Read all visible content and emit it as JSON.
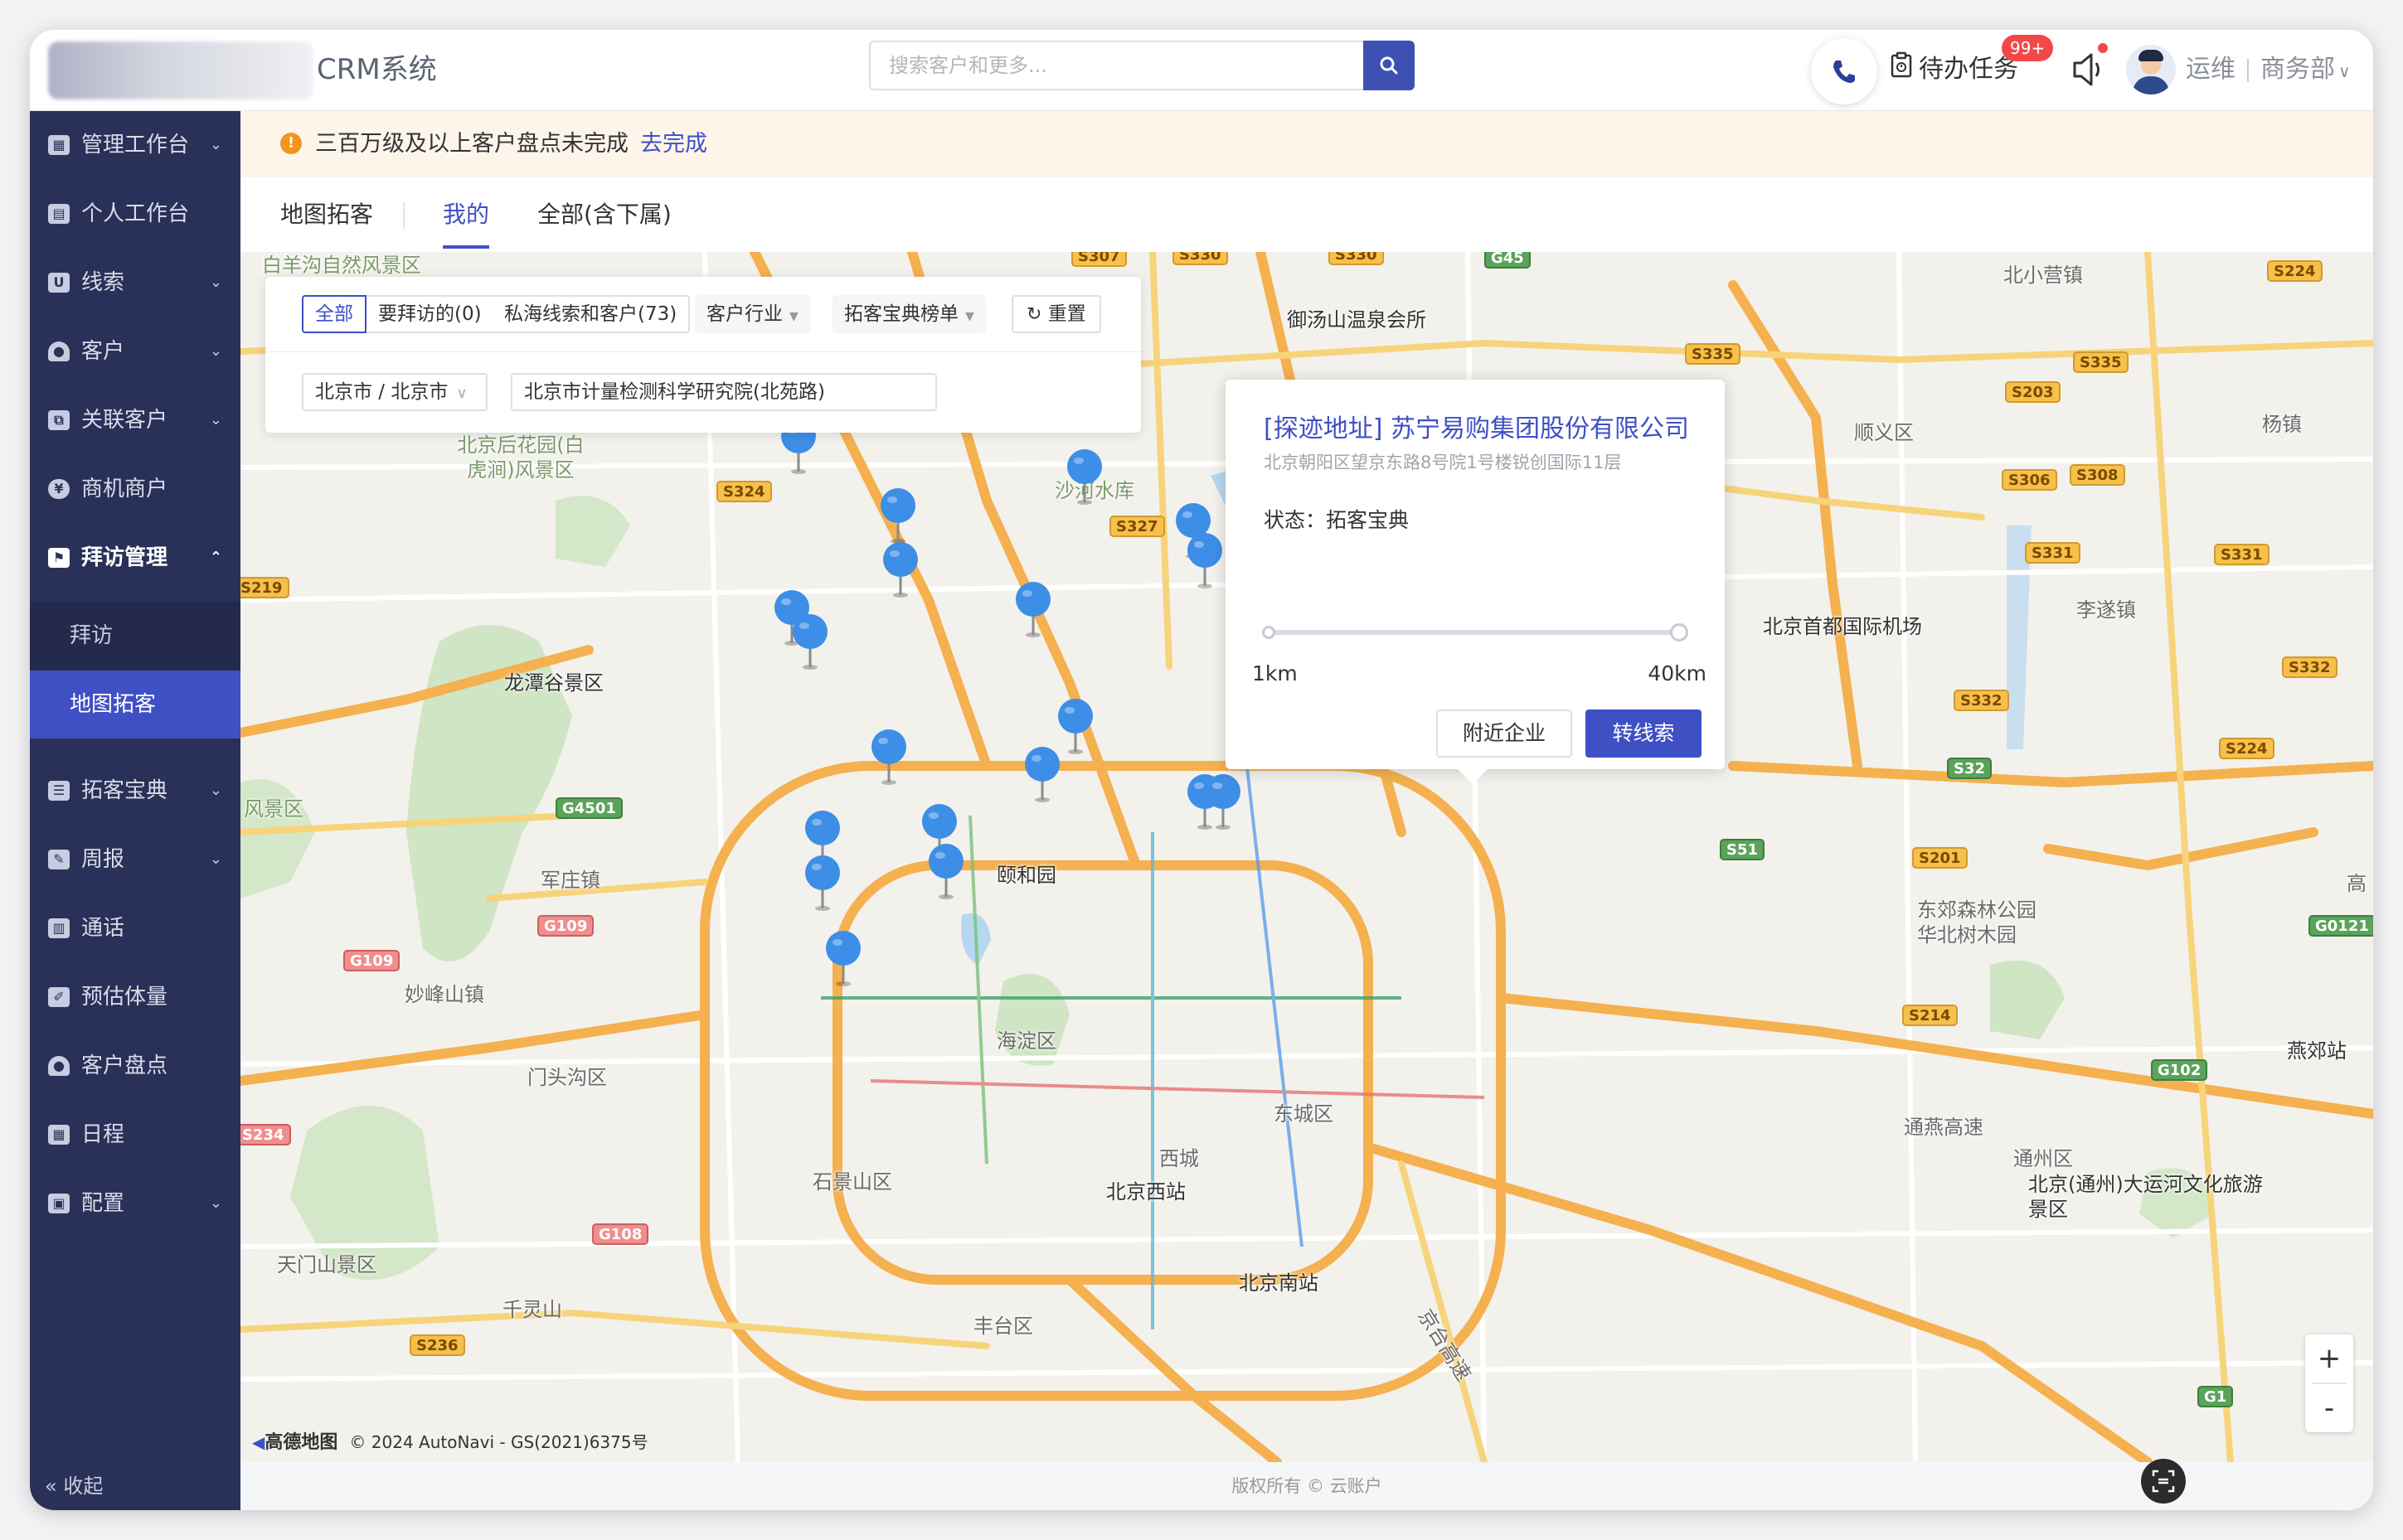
{
  "app": {
    "title": "CRM系统"
  },
  "search": {
    "placeholder": "搜索客户和更多..."
  },
  "header": {
    "todo_label": "待办任务",
    "todo_badge": "99+",
    "user_name": "运维",
    "department": "商务部"
  },
  "sidebar": {
    "items": [
      {
        "label": "管理工作台",
        "icon": "dashboard-icon",
        "expandable": true
      },
      {
        "label": "个人工作台",
        "icon": "personal-desk-icon",
        "expandable": false
      },
      {
        "label": "线索",
        "icon": "leads-icon",
        "expandable": true
      },
      {
        "label": "客户",
        "icon": "customer-icon",
        "expandable": true
      },
      {
        "label": "关联客户",
        "icon": "related-customer-icon",
        "expandable": true
      },
      {
        "label": "商机商户",
        "icon": "opportunity-icon",
        "expandable": false
      },
      {
        "label": "拜访管理",
        "icon": "visit-icon",
        "expandable": true,
        "expanded": true
      },
      {
        "label": "拓客宝典",
        "icon": "book-icon",
        "expandable": true
      },
      {
        "label": "周报",
        "icon": "weekly-report-icon",
        "expandable": true
      },
      {
        "label": "通话",
        "icon": "call-icon",
        "expandable": false
      },
      {
        "label": "预估体量",
        "icon": "estimate-icon",
        "expandable": false
      },
      {
        "label": "客户盘点",
        "icon": "inventory-icon",
        "expandable": false
      },
      {
        "label": "日程",
        "icon": "calendar-icon",
        "expandable": false
      },
      {
        "label": "配置",
        "icon": "config-icon",
        "expandable": true
      }
    ],
    "subitems": [
      {
        "label": "拜访",
        "selected": false
      },
      {
        "label": "地图拓客",
        "selected": true
      }
    ],
    "collapse_label": "收起"
  },
  "notice": {
    "text": "三百万级及以上客户盘点未完成",
    "link": "去完成"
  },
  "tabs": [
    {
      "label": "地图拓客",
      "active": false
    },
    {
      "label": "我的",
      "active": true
    },
    {
      "label": "全部(含下属)",
      "active": false
    }
  ],
  "filters": {
    "segments": [
      {
        "label": "全部",
        "selected": true
      },
      {
        "label": "要拜访的(0)",
        "selected": false
      },
      {
        "label": "私海线索和客户(73)",
        "selected": false
      }
    ],
    "industry_label": "客户行业",
    "ranking_label": "拓客宝典榜单",
    "reset_label": "重置",
    "city_value": "北京市 / 北京市",
    "address_value": "北京市计量检测科学研究院(北苑路)"
  },
  "popup": {
    "title": "[探迹地址] 苏宁易购集团股份有限公司",
    "address": "北京朝阳区望京东路8号院1号楼锐创国际11层",
    "status_label": "状态：",
    "status_value": "拓客宝典",
    "range_min": "1km",
    "range_max": "40km",
    "nearby_button": "附近企业",
    "convert_button": "转线索"
  },
  "map": {
    "labels": [
      "白羊沟自然风景区",
      "御汤山温泉会所",
      "北小营镇",
      "顺义区",
      "杨镇",
      "北京后花园(白虎涧)风景区",
      "沙河水库",
      "北京首都国际机场",
      "李遂镇",
      "龙潭谷景区",
      "风景区",
      "军庄镇",
      "颐和园",
      "东郊森林公园",
      "华北树木园",
      "妙峰山镇",
      "海淀区",
      "门头沟区",
      "燕郊站",
      "东城区",
      "通燕高速",
      "通州区",
      "石景山区",
      "西城",
      "北京西站",
      "北京(通州)大运河文化旅游景区",
      "天门山景区",
      "千灵山",
      "北京南站",
      "丰台区",
      "京台高速",
      "高"
    ],
    "road_shields": [
      "S307",
      "S330",
      "S330",
      "G45",
      "S224",
      "S335",
      "S203",
      "S335",
      "S324",
      "S327",
      "S306",
      "S308",
      "S331",
      "S331",
      "S219",
      "S332",
      "S332",
      "S224",
      "G4501",
      "S32",
      "S51",
      "S201",
      "G109",
      "G109",
      "G0121",
      "S214",
      "G102",
      "S234",
      "G108",
      "S236",
      "G1"
    ],
    "attribution_brand": "高德地图",
    "attribution_text": "© 2024 AutoNavi - GS(2021)6375号",
    "zoom_in": "+",
    "zoom_out": "-"
  },
  "footer": {
    "copyright": "版权所有 © 云账户"
  },
  "colors": {
    "primary": "#3f50c5",
    "sidebar_bg": "#2a3158",
    "pin_blue": "#3d8ee6",
    "pin_green": "#3fa752",
    "notice_bg": "#fdf5ea",
    "badge_red": "#f24848"
  }
}
